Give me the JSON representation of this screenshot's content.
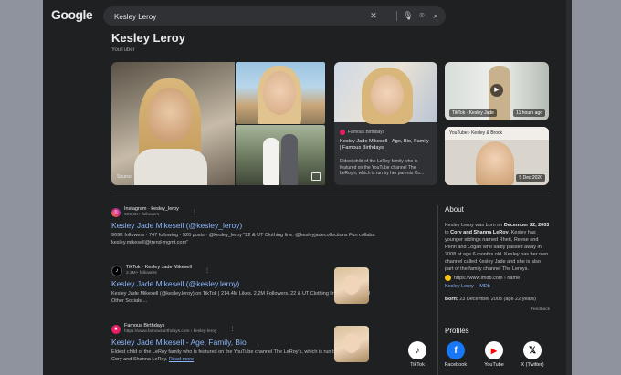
{
  "header": {
    "logo": "Google",
    "search_query": "Kesley Leroy"
  },
  "entity": {
    "title": "Kesley Leroy",
    "subtitle": "YouTuber"
  },
  "images": {
    "source_label": "Source",
    "famous_card": {
      "source": "Famous Birthdays",
      "title": "Kesley Jade Mikesell - Age, Bio, Family | Famous Birthdays",
      "desc": "Eldest child of the LeRoy family who is featured on the YouTube channel The LeRoy's, which is run by her parents Co..."
    },
    "tiktok_card": {
      "label": "TikTok · Kesley Jade",
      "age": "11 hours ago"
    },
    "youtube_card": {
      "label": "YouTube › Kesley & Brock",
      "age": "5 Dec 2020"
    }
  },
  "results": [
    {
      "source": "Instagram · kesley_leroy",
      "meta": "909.0K+ followers",
      "title": "Kesley Jade Mikesell (@kesley_leroy)",
      "desc": "909K followers · 747 following · 526 posts · @kesley_leroy \"22 & UT Clothing line: @kesleyjadecollections Fun collabs: kesley.mikesell@trend-mgmt.com\""
    },
    {
      "source": "TikTok · Kesley Jade Mikesell",
      "meta": "2.2M+ followers",
      "title": "Kesley Jade Mikesell (@kesley.leroy)",
      "desc": "Kesley Jade Mikesell (@kesley.leroy) on TikTok | 214.4M Likes. 2.2M Followers. 22 & UT Clothing line, ShopMy, and Other Socials ..."
    },
    {
      "source": "Famous Birthdays",
      "meta": "https://www.famousbirthdays.com › kesley-leroy",
      "title": "Kesley Jade Mikesell - Age, Family, Bio",
      "desc": "Eldest child of the LeRoy family who is featured on the YouTube channel The LeRoy's, which is run by her parents Cory and Shanna LeRoy.",
      "more": "Read more"
    }
  ],
  "about": {
    "heading": "About",
    "text_a": "Kesley Leroy was born on ",
    "text_b": "December 22, 2003",
    "text_c": " to ",
    "text_d": "Cory and Shanna LeRoy",
    "text_e": ". Kesley has younger siblings named Rhett, Reese and Penn and Logan who sadly passed away in 2008 at age 6 months old. Kesley has her own channel called Kesley Jade and she is also part of the family channel The Leroys.",
    "link_url": "https://www.imdb.com › name",
    "link_title": "Kesley Leroy - IMDb",
    "born_label": "Born:",
    "born_value": "23 December 2003 (age 22 years)",
    "feedback": "Feedback"
  },
  "profiles": {
    "heading": "Profiles",
    "items": [
      {
        "name": "TikTok",
        "glyph": "♪",
        "bg": "#ffffff",
        "fg": "#000000"
      },
      {
        "name": "Facebook",
        "glyph": "f",
        "bg": "#1877f2",
        "fg": "#ffffff"
      },
      {
        "name": "YouTube",
        "glyph": "▶",
        "bg": "#ffffff",
        "fg": "#ff0000"
      },
      {
        "name": "X (Twitter)",
        "glyph": "𝕏",
        "bg": "#ffffff",
        "fg": "#000000"
      }
    ]
  },
  "colors": {
    "background": "#1f2022",
    "link": "#8ab4f8",
    "text": "#e8eaed"
  }
}
